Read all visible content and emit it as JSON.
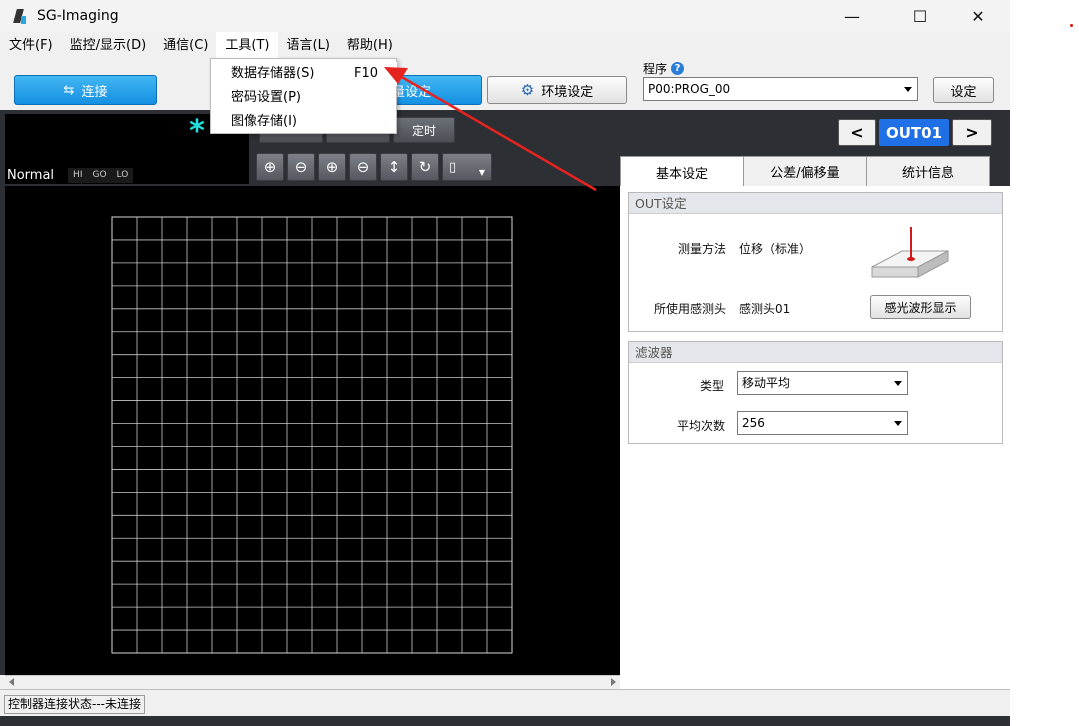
{
  "window": {
    "title": "SG-Imaging",
    "minimize": "—",
    "maximize": "☐",
    "close": "✕"
  },
  "menubar": [
    {
      "label": "文件(F)"
    },
    {
      "label": "监控/显示(D)"
    },
    {
      "label": "通信(C)"
    },
    {
      "label": "工具(T)"
    },
    {
      "label": "语言(L)"
    },
    {
      "label": "帮助(H)"
    }
  ],
  "tools_menu": {
    "items": [
      {
        "label": "数据存储器(S)",
        "shortcut": "F10"
      },
      {
        "label": "密码设置(P)",
        "shortcut": ""
      },
      {
        "label": "图像存储(I)",
        "shortcut": ""
      }
    ]
  },
  "toolbar": {
    "connect_label": "连接",
    "connect_icon": "swap-arrows-icon",
    "measure_setting_label": "量设定",
    "env_setting_label": "环境设定",
    "env_icon": "gear-icon",
    "program_label": "程序",
    "program_value": "P00:PROG_00",
    "set_label": "设定"
  },
  "display": {
    "stars": "***",
    "mode": "Normal",
    "judgements": [
      "HI",
      "GO",
      "LO"
    ],
    "timer_label": "定时",
    "icon_buttons": [
      "zoom-in-icon",
      "zoom-out-icon",
      "zoom-in-horizontal-icon",
      "zoom-out-horizontal-icon",
      "fit-vertical-icon",
      "refresh-icon",
      "cursor-dropdown-icon"
    ],
    "output_name": "OUT01"
  },
  "grid": {
    "cols": 16,
    "rows": 19
  },
  "tabs": [
    {
      "label": "基本设定",
      "active": true
    },
    {
      "label": "公差/偏移量",
      "active": false
    },
    {
      "label": "统计信息",
      "active": false
    }
  ],
  "out_settings": {
    "title": "OUT设定",
    "method_label": "测量方法",
    "method_value": "位移（标准）",
    "head_label": "所使用感测头",
    "head_value": "感测头01",
    "waveform_button": "感光波形显示"
  },
  "filter": {
    "title": "滤波器",
    "type_label": "类型",
    "type_value": "移动平均",
    "avg_label": "平均次数",
    "avg_value": "256"
  },
  "status": {
    "connection": "控制器连接状态---未连接"
  },
  "colors": {
    "accent_blue": "#1a8fe3",
    "output_blue": "#1f6fe6",
    "stars_cyan": "#21e0e0",
    "arrow_red": "#e52420"
  }
}
